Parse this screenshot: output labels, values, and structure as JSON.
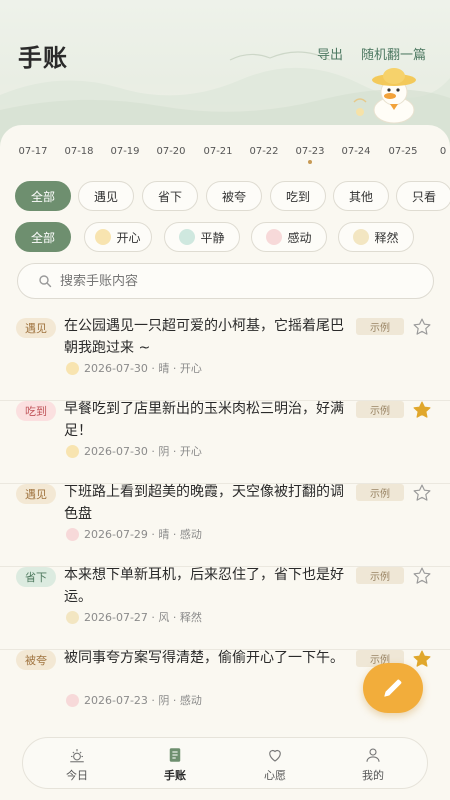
{
  "header": {
    "title": "手账",
    "export_label": "导出",
    "random_label": "随机翻一篇"
  },
  "dates": {
    "items": [
      "07-17",
      "07-18",
      "07-19",
      "07-20",
      "07-21",
      "07-22",
      "07-23",
      "07-24",
      "07-25",
      "0"
    ],
    "selected": "07-23"
  },
  "category_filters": [
    "全部",
    "遇见",
    "省下",
    "被夸",
    "吃到",
    "其他",
    "只看"
  ],
  "mood_filters": [
    {
      "label": "全部",
      "icon": ""
    },
    {
      "label": "开心",
      "icon": "happy-face-icon"
    },
    {
      "label": "平静",
      "icon": "calm-face-icon"
    },
    {
      "label": "感动",
      "icon": "touched-face-icon"
    },
    {
      "label": "释然",
      "icon": "relieved-face-icon"
    }
  ],
  "search": {
    "placeholder": "搜索手账内容"
  },
  "entries": [
    {
      "tag": "遇见",
      "text": "在公园遇见一只超可爱的小柯基，它摇着尾巴朝我跑过来 ~",
      "meta": "2026-07-30 · 晴 · 开心",
      "badge": "示例",
      "starred": false
    },
    {
      "tag": "吃到",
      "text": "早餐吃到了店里新出的玉米肉松三明治，好满足！",
      "meta": "2026-07-30 · 阴 · 开心",
      "badge": "示例",
      "starred": true
    },
    {
      "tag": "遇见",
      "text": "下班路上看到超美的晚霞，天空像被打翻的调色盘",
      "meta": "2026-07-29 · 晴 · 感动",
      "badge": "示例",
      "starred": false
    },
    {
      "tag": "省下",
      "text": "本来想下单新耳机，后来忍住了，省下也是好运。",
      "meta": "2026-07-27 · 风 · 释然",
      "badge": "示例",
      "starred": false
    },
    {
      "tag": "被夸",
      "text": "被同事夸方案写得清楚，偷偷开心了一下午。",
      "meta": "2026-07-23 · 阴 · 感动",
      "badge": "示例",
      "starred": true
    }
  ],
  "tabs": [
    {
      "label": "今日",
      "icon": "sun-icon"
    },
    {
      "label": "手账",
      "icon": "notebook-icon"
    },
    {
      "label": "心愿",
      "icon": "heart-icon"
    },
    {
      "label": "我的",
      "icon": "user-icon"
    }
  ],
  "active_tab": "手账",
  "colors": {
    "accent_green": "#6e8f6f",
    "star_gold": "#e0a72c",
    "fab_orange": "#f2ad3b"
  }
}
